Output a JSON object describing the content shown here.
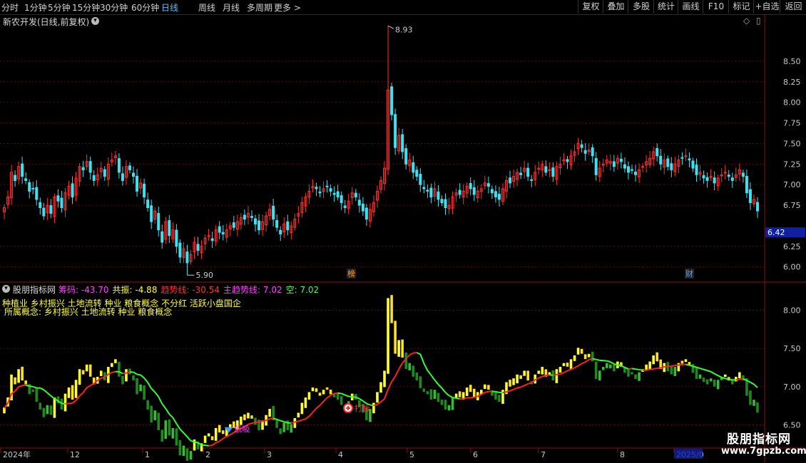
{
  "toolbar": {
    "periods": [
      "分时",
      "1分钟",
      "5分钟",
      "15分钟",
      "30分钟",
      "60分钟",
      "日线",
      "周线",
      "月线",
      "多周期",
      "更多 >"
    ],
    "active_period": "日线",
    "buttons": [
      "复权",
      "叠加",
      "多股",
      "统计",
      "画线",
      "F10",
      "标记",
      "+自选",
      "返回"
    ]
  },
  "stock": {
    "title": "新农开发(日线,前复权)"
  },
  "main_chart": {
    "y_ticks": [
      "8.50",
      "8.25",
      "8.00",
      "7.75",
      "7.50",
      "7.25",
      "7.00",
      "6.75",
      "6.25",
      "6.00"
    ],
    "current_price": "6.42",
    "max_label": "8.93",
    "min_label": "5.90",
    "markers": [
      "榜",
      "财"
    ]
  },
  "indicator": {
    "name": "股朋指标网",
    "items": [
      {
        "label": "筹码: -43.70",
        "color": "#ff40ff"
      },
      {
        "label": "共振: -4.88",
        "color": "#ffff40"
      },
      {
        "label": "趋势线: -30.54",
        "color": "#ff3030"
      },
      {
        "label": "主趋势线: 7.02",
        "color": "#ff40ff"
      },
      {
        "label": "空: 7.02",
        "color": "#40ff40"
      }
    ],
    "concept_line1": "种植业 乡村振兴 土地流转 种业 粮食概念 不分红 活跃小盘国企",
    "concept_line2": "所属概念: 乡村振兴 土地流转 种业 粮食概念",
    "y_ticks": [
      "8.00",
      "7.50",
      "7.00",
      "6.50"
    ],
    "signal_low": "低吸",
    "signal_board": "打板"
  },
  "x_axis": [
    "2024年",
    "12",
    "1",
    "2",
    "3",
    "4",
    "5",
    "6",
    "7",
    "8",
    "2025/0"
  ],
  "watermark": {
    "title": "股朋指标网",
    "url": "www.7gpzb.com"
  },
  "colors": {
    "up": "#ff3030",
    "down": "#40e0f0",
    "ma": "#ff2020",
    "ma_green": "#30ff30"
  },
  "chart_data": {
    "type": "candlestick",
    "title": "新农开发(日线,前复权)",
    "x_labels": [
      "2024年",
      "12",
      "1",
      "2",
      "3",
      "4",
      "5",
      "6",
      "7",
      "8",
      "2025/0"
    ],
    "ylim": [
      5.85,
      8.95
    ],
    "indicator_ylim": [
      6.3,
      8.35
    ],
    "closes": [
      6.72,
      6.85,
      7.15,
      7.05,
      7.22,
      7.1,
      7.05,
      6.92,
      6.95,
      6.82,
      6.72,
      6.62,
      6.75,
      6.65,
      6.85,
      6.8,
      6.72,
      6.9,
      6.98,
      6.85,
      7.08,
      7.22,
      7.18,
      7.28,
      7.15,
      7.05,
      7.12,
      7.2,
      7.1,
      7.25,
      7.3,
      7.35,
      7.15,
      7.05,
      7.22,
      7.18,
      7.1,
      6.92,
      7.02,
      6.85,
      6.72,
      6.55,
      6.68,
      6.45,
      6.3,
      6.55,
      6.38,
      6.45,
      6.25,
      6.12,
      6.22,
      6.05,
      6.15,
      6.3,
      6.2,
      6.25,
      6.35,
      6.38,
      6.32,
      6.45,
      6.42,
      6.4,
      6.45,
      6.5,
      6.48,
      6.55,
      6.6,
      6.58,
      6.65,
      6.6,
      6.52,
      6.45,
      6.55,
      6.62,
      6.7,
      6.58,
      6.48,
      6.4,
      6.52,
      6.45,
      6.5,
      6.58,
      6.65,
      6.78,
      6.85,
      6.92,
      6.98,
      6.95,
      6.9,
      6.95,
      6.98,
      6.92,
      6.88,
      6.85,
      6.78,
      6.72,
      6.8,
      6.9,
      6.85,
      6.75,
      6.68,
      6.58,
      6.7,
      6.78,
      6.92,
      7.05,
      7.2,
      8.15,
      7.85,
      7.45,
      7.6,
      7.4,
      7.25,
      7.3,
      7.15,
      7.1,
      7.0,
      6.95,
      6.92,
      6.85,
      6.95,
      6.82,
      6.78,
      6.72,
      6.75,
      6.85,
      6.9,
      6.88,
      6.92,
      6.98,
      6.95,
      6.88,
      6.92,
      6.95,
      7.02,
      6.98,
      6.9,
      6.85,
      6.82,
      6.95,
      7.05,
      7.02,
      7.1,
      7.15,
      7.12,
      7.2,
      7.1,
      7.05,
      7.15,
      7.2,
      7.25,
      7.15,
      7.18,
      7.1,
      7.22,
      7.25,
      7.3,
      7.28,
      7.35,
      7.4,
      7.5,
      7.45,
      7.38,
      7.42,
      7.35,
      7.12,
      7.2,
      7.25,
      7.3,
      7.28,
      7.22,
      7.32,
      7.28,
      7.2,
      7.15,
      7.18,
      7.12,
      7.18,
      7.22,
      7.28,
      7.32,
      7.4,
      7.35,
      7.25,
      7.3,
      7.22,
      7.18,
      7.25,
      7.3,
      7.32,
      7.35,
      7.3,
      7.2,
      7.12,
      7.15,
      7.08,
      7.05,
      7.1,
      7.02,
      7.08,
      7.12,
      7.15,
      7.1,
      7.05,
      7.12,
      7.18,
      7.1,
      6.9,
      6.78,
      6.82,
      6.68
    ]
  }
}
